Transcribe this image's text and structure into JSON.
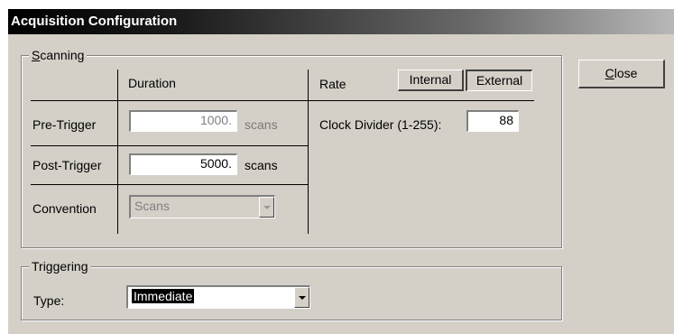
{
  "window": {
    "title": "Acquisition Configuration"
  },
  "scanning": {
    "legend_accel": "S",
    "legend_rest": "canning",
    "duration_header": "Duration",
    "rate_header": "Rate",
    "internal_label": "Internal",
    "external_label": "External",
    "rows": {
      "pre_trigger": {
        "label": "Pre-Trigger",
        "value": "1000.",
        "unit": "scans"
      },
      "post_trigger": {
        "label": "Post-Trigger",
        "value": "5000.",
        "unit": "scans"
      },
      "convention": {
        "label": "Convention",
        "value": "Scans"
      }
    },
    "clock_divider": {
      "label": "Clock Divider (1-255):",
      "value": "88"
    }
  },
  "triggering": {
    "legend": "Triggering",
    "type_label": "Type:",
    "type_value": "Immediate"
  },
  "close": {
    "accel": "C",
    "rest": "lose"
  },
  "icons": {
    "dropdown": "chevron-down-icon"
  }
}
